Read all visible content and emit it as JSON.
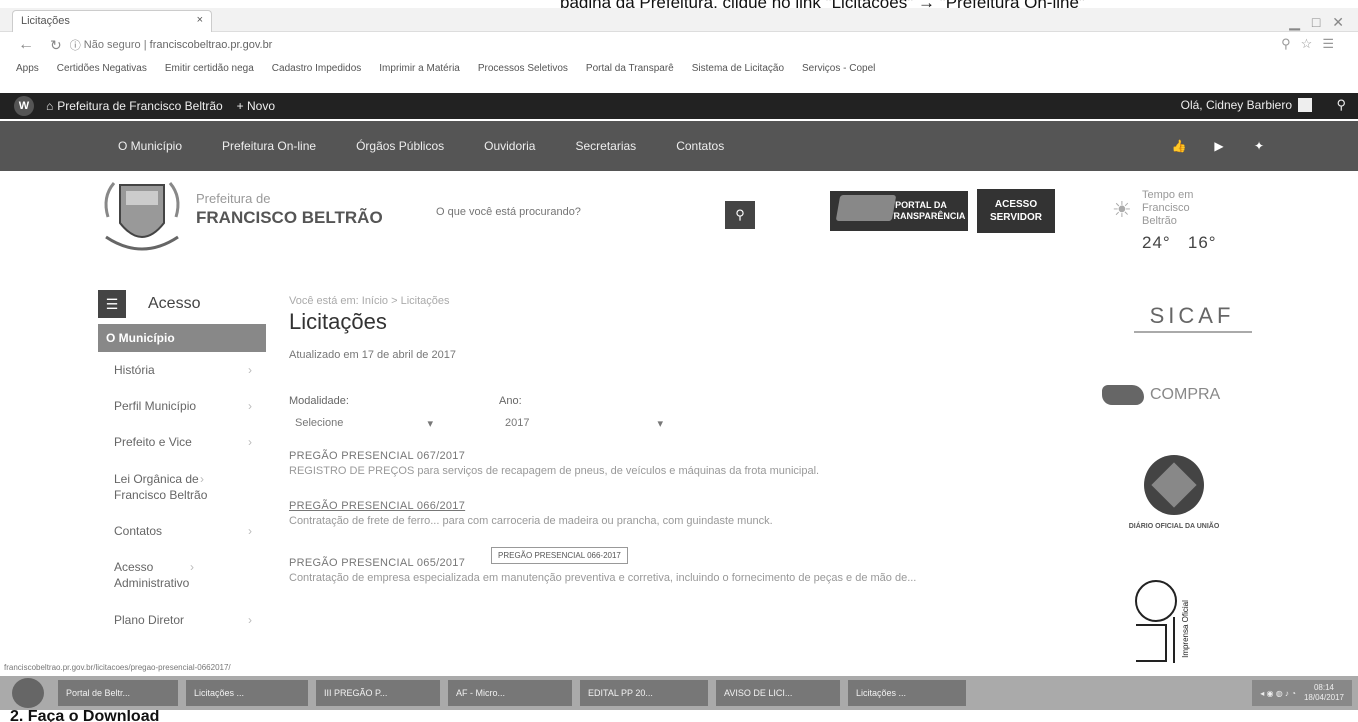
{
  "caption": {
    "text": "página da Prefeitura, clique no link \"Licitações\" → \"Prefeitura On-line\""
  },
  "browser": {
    "tab_title": "Licitações",
    "tab_close": "×",
    "secure_label": "Não seguro",
    "url": "franciscobeltrao.pr.gov.br",
    "bookmarks": [
      "Apps",
      "Certidões Negativas",
      "Emitir certidão nega",
      "Cadastro Impedidos",
      "Imprimir a Matéria",
      "Processos Seletivos",
      "Portal da Transparê",
      "Sistema de Licitação",
      "Serviços - Copel"
    ]
  },
  "wp_admin_bar": {
    "site_name": "Prefeitura de Francisco Beltrão",
    "new_label": "+ Novo",
    "greeting": "Olá, Cidney Barbiero"
  },
  "main_nav": {
    "items": [
      "O Município",
      "Prefeitura On-line",
      "Órgãos Públicos",
      "Ouvidoria",
      "Secretarias",
      "Contatos"
    ]
  },
  "header": {
    "brand_line1": "Prefeitura de",
    "brand_line2": "FRANCISCO BELTRÃO",
    "search_placeholder": "O que você está procurando?",
    "portal_label": "PORTAL DA TRANSPARÊNCIA",
    "servidor_label": "ACESSO SERVIDOR",
    "weather_label": "Tempo em Francisco Beltrão",
    "temp_max": "24°",
    "temp_min": "16°"
  },
  "sidebar": {
    "title": "Acesso",
    "active": "O Município",
    "items": [
      "História",
      "Perfil Município",
      "Prefeito e Vice",
      "Lei Orgânica de Francisco Beltrão",
      "Contatos",
      "Acesso Administrativo",
      "Plano Diretor"
    ]
  },
  "content": {
    "breadcrumb": "Você está em: Início > Licitações",
    "title": "Licitações",
    "updated": "Atualizado em 17 de abril de 2017",
    "modalidade_label": "Modalidade:",
    "modalidade_value": "Selecione",
    "ano_label": "Ano:",
    "ano_value": "2017",
    "bids": [
      {
        "title": "PREGÃO PRESENCIAL 067/2017",
        "desc": "REGISTRO DE PREÇOS para serviços de recapagem de pneus, de veículos e máquinas da frota municipal."
      },
      {
        "title": "PREGÃO PRESENCIAL 066/2017",
        "desc": "Contratação de frete de ferro... para com carroceria de madeira ou prancha, com guindaste munck."
      },
      {
        "title": "PREGÃO PRESENCIAL 065/2017",
        "desc": "Contratação de empresa especializada em manutenção preventiva e corretiva, incluindo o fornecimento de peças e de mão de..."
      }
    ],
    "tooltip": "PREGÃO PRESENCIAL 066-2017"
  },
  "right_column": {
    "sicaf_label": "SICAF",
    "compra_label": "COMPRA",
    "dou_label": "DIÁRIO OFICIAL DA UNIÃO",
    "imprensa_label": "Imprensa Oficial"
  },
  "status_url": "franciscobeltrao.pr.gov.br/licitacoes/pregao-presencial-0662017/",
  "taskbar": {
    "tasks": [
      "Portal de Beltr...",
      "Licitações ...",
      "III PREGÃO P...",
      "AF - Micro...",
      "EDITAL PP 20...",
      "AVISO DE LICI...",
      "Licitações ..."
    ],
    "clock_time": "08:14",
    "clock_date": "18/04/2017"
  },
  "bottom_caption": {
    "text": "2. Faça o Download"
  }
}
